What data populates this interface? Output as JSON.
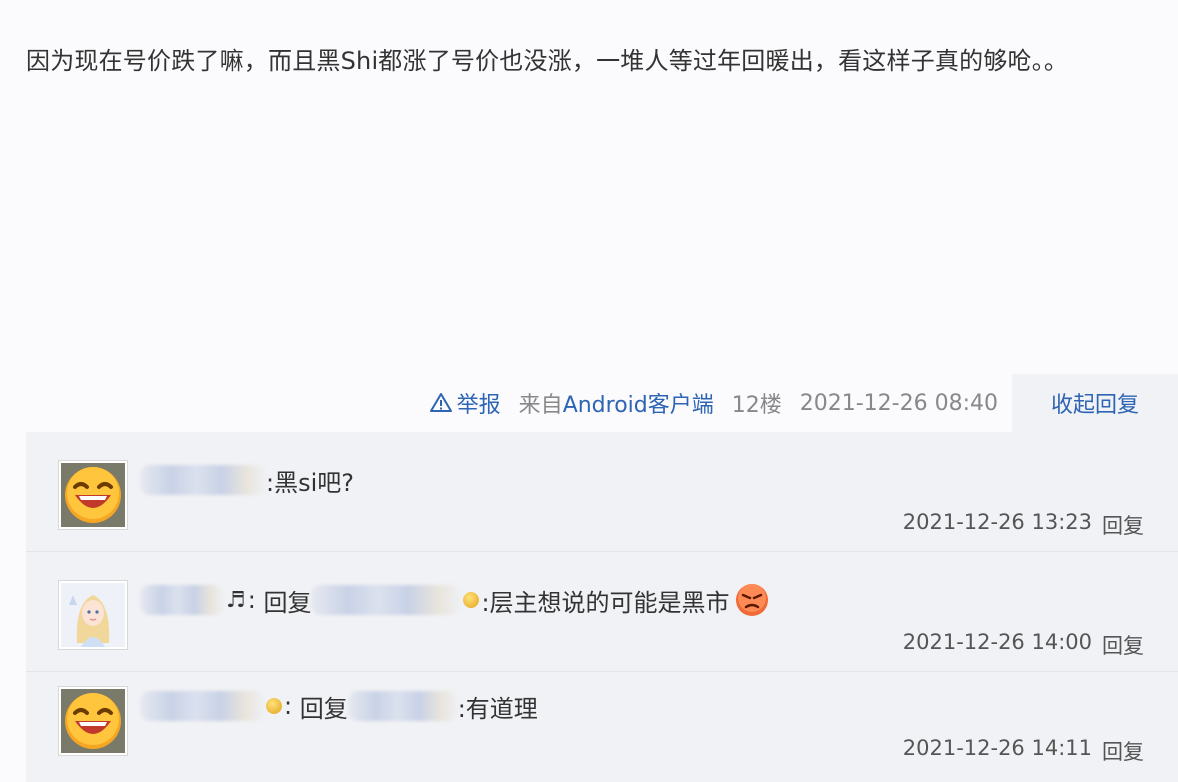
{
  "post": {
    "text": "因为现在号价跌了嘛，而且黑Shi都涨了号价也没涨，一堆人等过年回暖出，看这样子真的够呛。。"
  },
  "meta": {
    "report_label": "举报",
    "source_prefix": "来自",
    "source_client": "Android客户端",
    "floor": "12楼",
    "time": "2021-12-26 08:40",
    "collapse_label": "收起回复"
  },
  "replies": [
    {
      "avatar_icon": "laughing-face-icon",
      "text": ":黑si吧?",
      "time": "2021-12-26 13:23",
      "reply_label": "回复"
    },
    {
      "avatar_icon": "anime-girl-avatar-icon",
      "prefix": "回复",
      "text": ":层主想说的可能是黑市",
      "time": "2021-12-26 14:00",
      "reply_label": "回复"
    },
    {
      "avatar_icon": "laughing-face-icon",
      "prefix": "回复",
      "text": ":有道理",
      "time": "2021-12-26 14:11",
      "reply_label": "回复"
    }
  ],
  "colors": {
    "link": "#2d64b3",
    "reply_bg": "#f1f2f5",
    "page_bg": "#fbfbfd"
  }
}
